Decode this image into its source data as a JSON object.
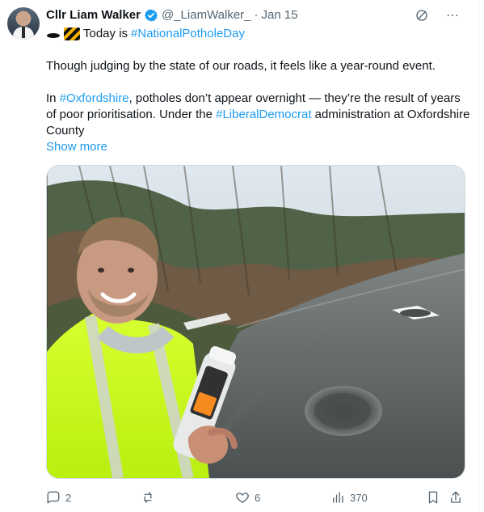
{
  "post": {
    "author_name": "Cllr Liam Walker",
    "handle": "@_LiamWalker_",
    "separator": "·",
    "date": "Jan 15",
    "line1_prefix": "Today is",
    "line1_hashtag": "#NationalPotholeDay",
    "paragraph1": "Though judging by the state of our roads, it feels like a year-round event.",
    "p2_a": "In ",
    "p2_tag1": "#Oxfordshire",
    "p2_b": ", potholes don’t appear overnight — they’re the result of years of poor prioritisation. Under the ",
    "p2_tag2": "#LiberalDemocrat",
    "p2_c": " administration at Oxfordshire County",
    "show_more": "Show more"
  },
  "icons": {
    "verified": "verified-badge-icon",
    "grok": "grok-icon",
    "more": "more-icon",
    "reply": "reply-icon",
    "repost": "repost-icon",
    "like": "heart-icon",
    "views": "views-icon",
    "bookmark": "bookmark-icon",
    "share": "share-icon"
  },
  "metrics": {
    "replies": "2",
    "reposts": "",
    "likes": "6",
    "views": "370"
  },
  "colors": {
    "link": "#1d9bf0",
    "secondary_text": "#536471",
    "verified": "#1d9bf0"
  }
}
